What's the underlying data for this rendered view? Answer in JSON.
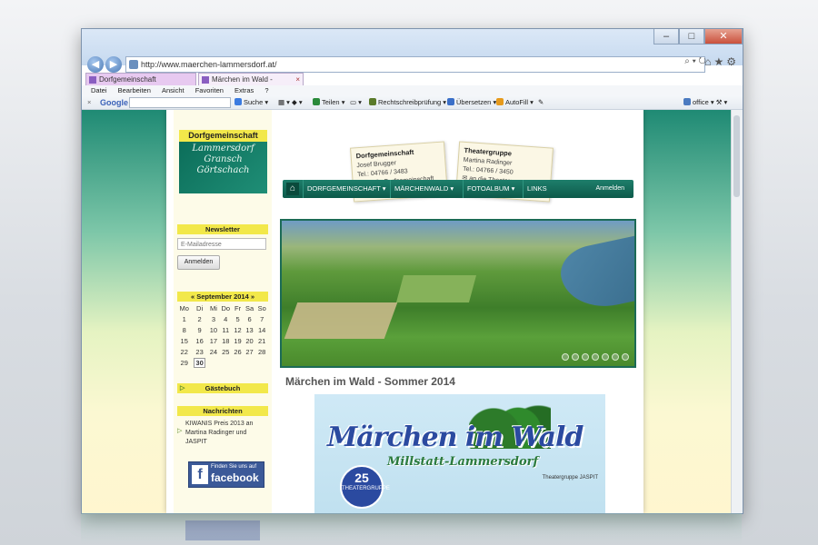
{
  "browser": {
    "url": "http://www.maerchen-lammersdorf.at/",
    "tabs": [
      {
        "label": "Dorfgemeinschaft Lammersdo..."
      },
      {
        "label": "Märchen im Wald - Somme..."
      }
    ],
    "menu": [
      "Datei",
      "Bearbeiten",
      "Ansicht",
      "Favoriten",
      "Extras",
      "?"
    ],
    "toolbar": {
      "google": "Google",
      "search": "Suche",
      "share": "Teilen",
      "spell": "Rechtschreibprüfung",
      "translate": "Übersetzen",
      "autofill": "AutoFill",
      "user": "office"
    }
  },
  "site": {
    "logo": {
      "title": "Dorfgemeinschaft",
      "lines": [
        "Lammersdorf",
        "Gransch",
        "Görtschach"
      ]
    },
    "cards": [
      {
        "title": "Dorfgemeinschaft",
        "name": "Josef Brugger",
        "tel": "Tel.: 04766 / 3483",
        "mail": "an die Dorfgemeinschaft"
      },
      {
        "title": "Theatergruppe",
        "name": "Martina Radinger",
        "tel": "Tel.: 04766 / 3450",
        "mail": "an die Theatergruppe"
      }
    ],
    "nav": {
      "items": [
        "DORFGEMEINSCHAFT",
        "MÄRCHENWALD",
        "FOTOALBUM",
        "LINKS"
      ],
      "login": "Anmelden"
    },
    "newsletter": {
      "title": "Newsletter",
      "placeholder": "E-Mailadresse",
      "button": "Anmelden"
    },
    "calendar": {
      "title": "« September 2014 »",
      "days": [
        "Mo",
        "Di",
        "Mi",
        "Do",
        "Fr",
        "Sa",
        "So"
      ],
      "weeks": [
        [
          "1",
          "2",
          "3",
          "4",
          "5",
          "6",
          "7"
        ],
        [
          "8",
          "9",
          "10",
          "11",
          "12",
          "13",
          "14"
        ],
        [
          "15",
          "16",
          "17",
          "18",
          "19",
          "20",
          "21"
        ],
        [
          "22",
          "23",
          "24",
          "25",
          "26",
          "27",
          "28"
        ],
        [
          "29",
          "30",
          "",
          "",
          "",
          "",
          ""
        ]
      ]
    },
    "guestbook": "Gästebuch",
    "news": {
      "title": "Nachrichten",
      "item": "KIWANIS Preis 2013 an Martina Radinger und JASPIT"
    },
    "facebook": {
      "small": "Finden Sie uns auf",
      "big": "facebook"
    },
    "article": {
      "title": "Märchen im Wald - Sommer 2014",
      "poster_title": "Märchen im Wald",
      "poster_sub": "Millstatt-Lammersdorf",
      "seal_number": "25",
      "seal_text": "THEATERGRUPPE",
      "small": "Theatergruppe JASPIT"
    },
    "slider_dots": 7
  }
}
